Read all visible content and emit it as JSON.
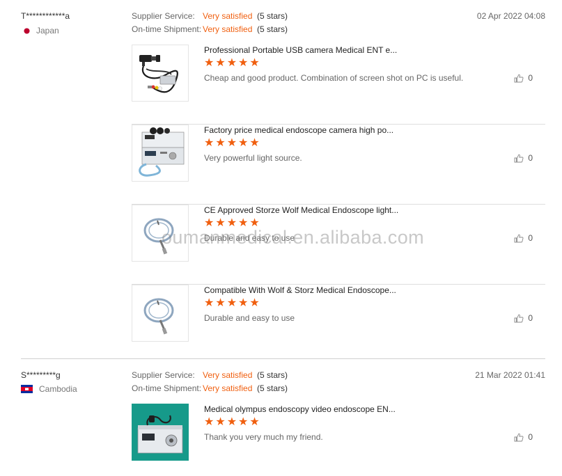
{
  "reviews": [
    {
      "reviewer": "T************a",
      "country": "Japan",
      "date": "02 Apr 2022 04:08",
      "supplier_service": {
        "label": "Supplier Service:",
        "value": "Very satisfied",
        "stars": "(5 stars)"
      },
      "on_time_shipment": {
        "label": "On-time Shipment:",
        "value": "Very satisfied",
        "stars": "(5 stars)"
      },
      "products": [
        {
          "title": "Professional Portable USB camera Medical ENT e...",
          "rating": 5,
          "text": "Cheap and good product. Combination of screen shot on PC is useful.",
          "likes": "0",
          "image": "usb-camera-icon"
        },
        {
          "title": "Factory price medical endoscope camera high po...",
          "rating": 5,
          "text": "Very powerful light source.",
          "likes": "0",
          "image": "endoscope-camera-system-icon"
        },
        {
          "title": "CE Approved Storze Wolf Medical Endoscope light...",
          "rating": 5,
          "text": "Durable and easy to use",
          "likes": "0",
          "image": "light-cable-icon"
        },
        {
          "title": "Compatible With Wolf & Storz Medical Endoscope...",
          "rating": 5,
          "text": "Durable and easy to use",
          "likes": "0",
          "image": "light-cable-icon"
        }
      ]
    },
    {
      "reviewer": "S*********g",
      "country": "Cambodia",
      "date": "21 Mar 2022 01:41",
      "supplier_service": {
        "label": "Supplier Service:",
        "value": "Very satisfied",
        "stars": "(5 stars)"
      },
      "on_time_shipment": {
        "label": "On-time Shipment:",
        "value": "Very satisfied",
        "stars": "(5 stars)"
      },
      "products": [
        {
          "title": "Medical olympus endoscopy video endoscope EN...",
          "rating": 5,
          "text": "Thank you very much my friend.",
          "likes": "0",
          "image": "video-endoscope-system-icon"
        }
      ]
    }
  ],
  "watermark": "oumanmedical.en.alibaba.com",
  "colors": {
    "accent": "#f05f0f",
    "divider": "#dedede",
    "flag_japan": "#bc002d",
    "flag_cambodia_blue": "#032ea1",
    "flag_cambodia_red": "#e00025"
  }
}
